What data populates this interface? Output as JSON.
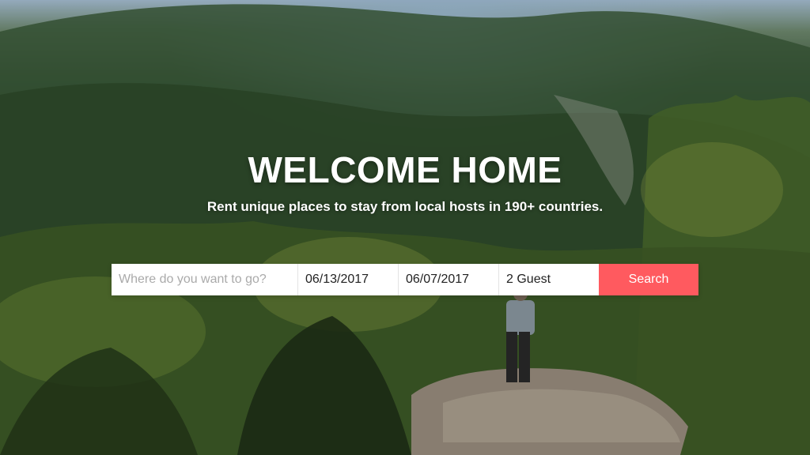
{
  "hero": {
    "title": "WELCOME HOME",
    "subtitle": "Rent unique places to stay from local hosts in 190+ countries.",
    "background_description_colors": {
      "sky": "#a9c2d6",
      "forest_dark": "#2a4226",
      "forest_light": "#5f7d3a"
    }
  },
  "search": {
    "where_placeholder": "Where do you want to go?",
    "where_value": "",
    "checkin_value": "06/13/2017",
    "checkout_value": "06/07/2017",
    "guests_value": "2 Guest",
    "button_label": "Search",
    "button_color": "#ff5a5f"
  }
}
